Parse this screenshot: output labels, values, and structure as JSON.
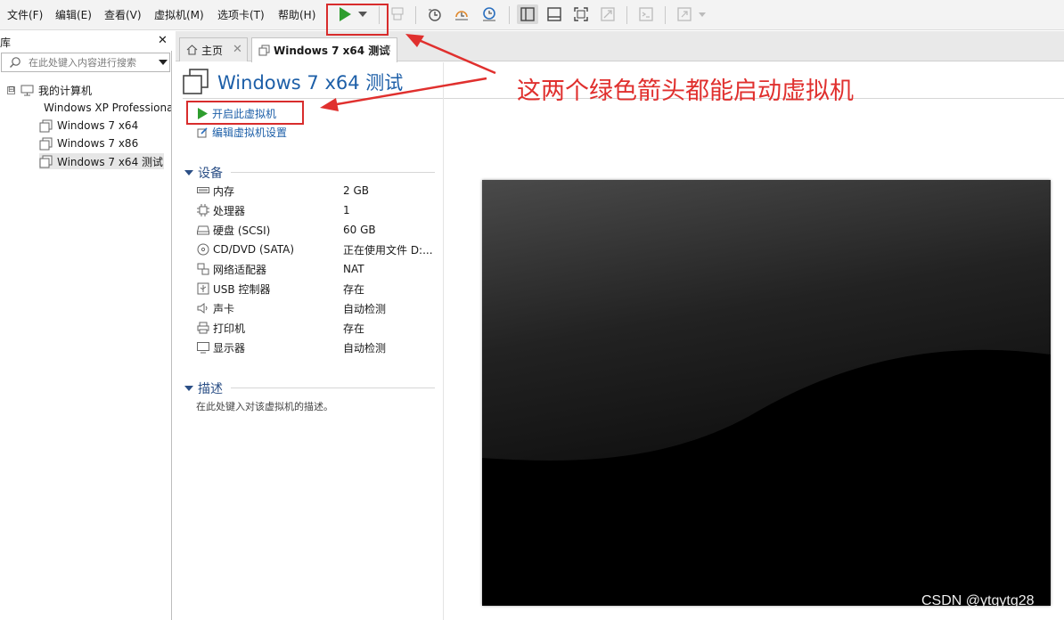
{
  "menu": [
    {
      "label": "文件(F)"
    },
    {
      "label": "编辑(E)"
    },
    {
      "label": "查看(V)"
    },
    {
      "label": "虚拟机(M)"
    },
    {
      "label": "选项卡(T)"
    },
    {
      "label": "帮助(H)"
    }
  ],
  "toolbar": {
    "icons": [
      "play-icon",
      "chevron-down-icon",
      "send-keys-icon",
      "snapshot-icon",
      "revert-snapshot-icon",
      "snapshot-manager-icon",
      "library-view-icon",
      "thumbnail-bar-icon",
      "full-screen-icon",
      "unity-icon",
      "console-view-icon",
      "stretch-view-icon"
    ],
    "accent_color": "#2e9d2e"
  },
  "library": {
    "title": "库",
    "close": "✕",
    "search_placeholder": "在此处键入内容进行搜索",
    "root_expander": "⊟",
    "root_label": "我的计算机",
    "items": [
      {
        "label": "Windows XP Professional"
      },
      {
        "label": "Windows 7 x64"
      },
      {
        "label": "Windows 7 x86"
      },
      {
        "label": "Windows 7 x64 测试"
      }
    ]
  },
  "tabs": [
    {
      "label": "主页",
      "close": "✕"
    },
    {
      "label": "Windows 7 x64 测试",
      "close": "✕"
    }
  ],
  "vm": {
    "title": "Windows 7 x64 测试",
    "commands": [
      {
        "label": "开启此虚拟机"
      },
      {
        "label": "编辑虚拟机设置"
      }
    ],
    "devices_heading": "设备",
    "devices": [
      {
        "icon": "memory-icon",
        "name": "内存",
        "value": "2 GB"
      },
      {
        "icon": "processor-icon",
        "name": "处理器",
        "value": "1"
      },
      {
        "icon": "hard-disk-icon",
        "name": "硬盘 (SCSI)",
        "value": "60 GB"
      },
      {
        "icon": "cd-dvd-icon",
        "name": "CD/DVD (SATA)",
        "value": "正在使用文件 D:..."
      },
      {
        "icon": "network-adapter-icon",
        "name": "网络适配器",
        "value": "NAT"
      },
      {
        "icon": "usb-icon",
        "name": "USB 控制器",
        "value": "存在"
      },
      {
        "icon": "sound-icon",
        "name": "声卡",
        "value": "自动检测"
      },
      {
        "icon": "printer-icon",
        "name": "打印机",
        "value": "存在"
      },
      {
        "icon": "display-icon",
        "name": "显示器",
        "value": "自动检测"
      }
    ],
    "description_heading": "描述",
    "description_placeholder": "在此处键入对该虚拟机的描述。"
  },
  "annotation": {
    "caption": "这两个绿色箭头都能启动虚拟机",
    "color": "#d82c2c"
  },
  "watermark": "CSDN @ytgytg28"
}
